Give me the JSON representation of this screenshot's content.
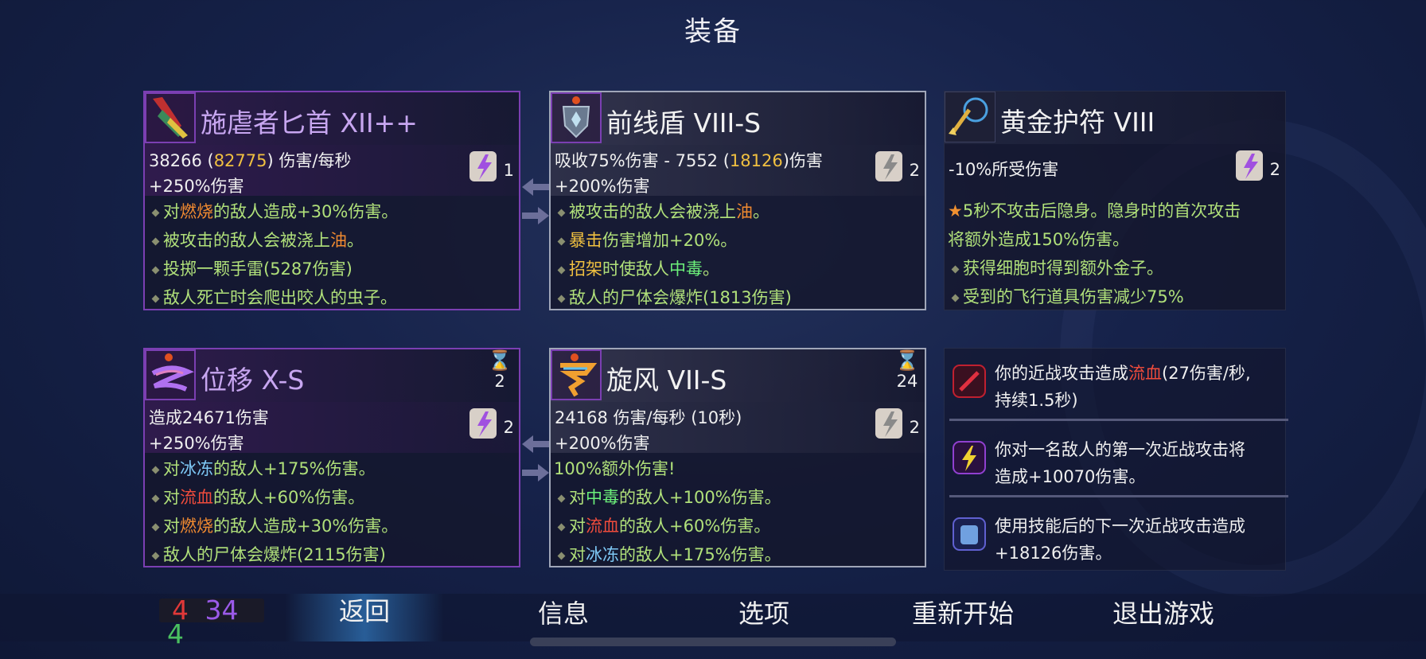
{
  "title": "装备",
  "colors": {
    "purple_border": "#7b3fb2",
    "white_border": "#a0a6b8",
    "green_text": "#b0e07a",
    "gold": "#f0c040",
    "fire": "#f08a30",
    "bleed": "#f04c3c",
    "ice": "#7ec8f5",
    "poison": "#6cf07a"
  },
  "cards": {
    "dagger": {
      "icon": "dagger-icon",
      "name": "施虐者匕首 XII++",
      "dps_base": "38266 (",
      "dps_alt": "82775",
      "dps_unit": ") 伤害/每秒",
      "bonus": "+250%伤害",
      "scroll_count": "1",
      "lines": [
        {
          "a": "对",
          "h": "燃烧",
          "b": "的敌人造成+30%伤害。"
        },
        {
          "a": "被攻击的敌人会被浇上",
          "h": "油",
          "b": "。"
        },
        {
          "a": "投掷一颗手雷(5287伤害)",
          "h": "",
          "b": ""
        },
        {
          "a": "敌人死亡时会爬出咬人的虫子。",
          "h": "",
          "b": ""
        }
      ]
    },
    "shield": {
      "icon": "shield-icon",
      "name": "前线盾 VIII-S",
      "stat_a": "吸收75%伤害 - 7552 (",
      "stat_alt": "18126",
      "stat_b": ")伤害",
      "bonus": "+200%伤害",
      "scroll_count": "2",
      "lines": [
        {
          "a": "被攻击的敌人会被浇上",
          "h": "油",
          "b": "。"
        },
        {
          "a": "",
          "h": "暴击",
          "b": "伤害增加+20%。"
        },
        {
          "a": "",
          "h": "招架",
          "b": "时使敌人",
          "h2": "中毒",
          "c": "。"
        },
        {
          "a": "敌人的尸体会爆炸(1813伤害)",
          "h": "",
          "b": ""
        }
      ]
    },
    "amulet": {
      "icon": "amulet-icon",
      "name": "黄金护符 VIII",
      "stat": "-10%所受伤害",
      "scroll_count": "2",
      "star_line_1": "5秒不攻击后隐身。隐身时的首次攻击",
      "star_line_2": "将额外造成150%伤害。",
      "lines": [
        {
          "a": "获得细胞时得到额外金子。"
        },
        {
          "a": "受到的飞行道具伤害减少75%"
        }
      ]
    },
    "phase": {
      "icon": "phase-icon",
      "name": "位移 X-S",
      "cooldown": "2",
      "stat": "造成24671伤害",
      "bonus": "+250%伤害",
      "scroll_count": "2",
      "lines": [
        {
          "a": "对",
          "h": "冰冻",
          "b": "的敌人+175%伤害。",
          "cls": "ice"
        },
        {
          "a": "对",
          "h": "流血",
          "b": "的敌人+60%伤害。",
          "cls": "blood"
        },
        {
          "a": "对",
          "h": "燃烧",
          "b": "的敌人造成+30%伤害。",
          "cls": "fire"
        },
        {
          "a": "敌人的尸体会爆炸(2115伤害)",
          "h": "",
          "b": "",
          "cls": ""
        }
      ]
    },
    "tornado": {
      "icon": "tornado-icon",
      "name": "旋风 VII-S",
      "cooldown": "24",
      "stat": "24168 伤害/每秒 (10秒)",
      "bonus": "+200%伤害",
      "scroll_count": "2",
      "extra": "100%额外伤害!",
      "lines": [
        {
          "a": "对",
          "h": "中毒",
          "b": "的敌人+100%伤害。",
          "cls": "poison"
        },
        {
          "a": "对",
          "h": "流血",
          "b": "的敌人+60%伤害。",
          "cls": "blood"
        },
        {
          "a": "对",
          "h": "冰冻",
          "b": "的敌人+175%伤害。",
          "cls": "ice"
        }
      ]
    }
  },
  "mutations": [
    {
      "icon": "bleed-mutation-icon",
      "a": "你的近战攻击造成",
      "h": "流血",
      "b": "(27伤害/秒,",
      "c": "持续1.5秒)"
    },
    {
      "icon": "lightning-mutation-icon",
      "a": "你对一名敌人的第一次近战攻击将",
      "c": "造成+10070伤害。"
    },
    {
      "icon": "scroll-mutation-icon",
      "a": "使用技能后的下一次近战攻击造成",
      "c": "+18126伤害。"
    }
  ],
  "scrolls": {
    "brutality": "4",
    "tactics": "34",
    "survival": "4"
  },
  "nav": [
    "返回",
    "信息",
    "选项",
    "重新开始",
    "退出游戏"
  ]
}
